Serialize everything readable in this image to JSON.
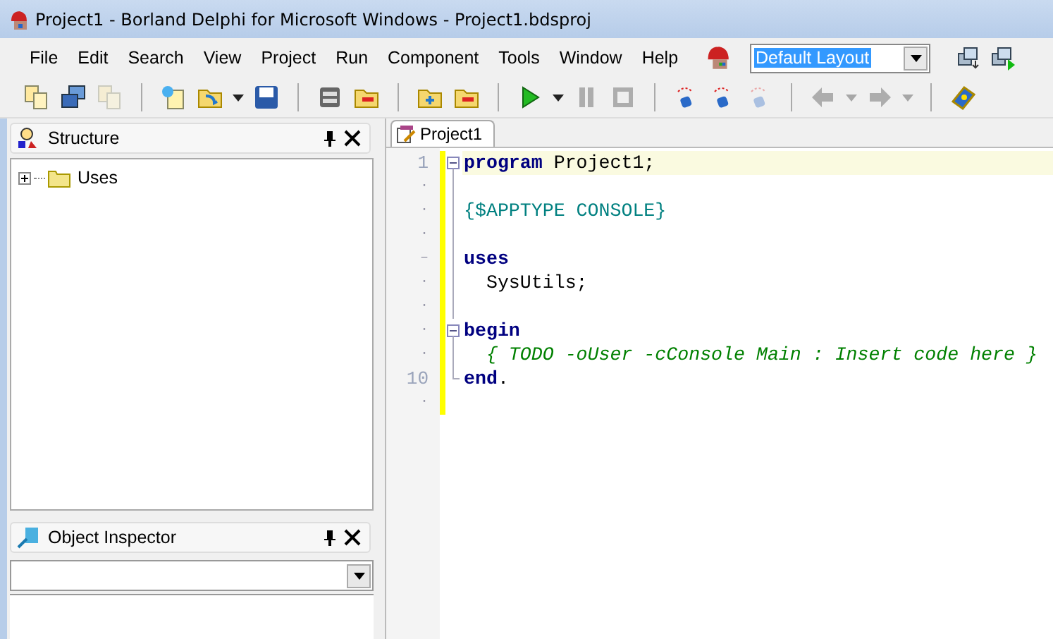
{
  "window": {
    "title": "Project1 - Borland Delphi for Microsoft Windows - Project1.bdsproj"
  },
  "menu": [
    "File",
    "Edit",
    "Search",
    "View",
    "Project",
    "Run",
    "Component",
    "Tools",
    "Window",
    "Help"
  ],
  "layout_combo": {
    "value": "Default Layout"
  },
  "layout_buttons": [
    {
      "kind": "save-layout",
      "disabled": false
    },
    {
      "kind": "apply-layout",
      "disabled": false
    }
  ],
  "toolbar": [
    {
      "buttons": [
        {
          "kind": "pages",
          "disabled": false
        },
        {
          "kind": "windows",
          "disabled": false
        },
        {
          "kind": "pages",
          "disabled": true
        }
      ]
    },
    {
      "buttons": [
        {
          "kind": "new",
          "disabled": false
        },
        {
          "kind": "open",
          "disabled": false
        },
        {
          "kind": "caret",
          "disabled": false
        },
        {
          "kind": "save",
          "disabled": false
        }
      ]
    },
    {
      "buttons": [
        {
          "kind": "stack",
          "disabled": false
        },
        {
          "kind": "remove",
          "disabled": false
        }
      ]
    },
    {
      "buttons": [
        {
          "kind": "add",
          "disabled": false
        },
        {
          "kind": "remove",
          "disabled": false
        }
      ]
    },
    {
      "buttons": [
        {
          "kind": "play",
          "disabled": false
        },
        {
          "kind": "caret",
          "disabled": false
        },
        {
          "kind": "pause",
          "disabled": true
        },
        {
          "kind": "stop",
          "disabled": true
        }
      ]
    },
    {
      "buttons": [
        {
          "kind": "step",
          "disabled": false
        },
        {
          "kind": "step",
          "disabled": false
        },
        {
          "kind": "step",
          "disabled": true
        }
      ]
    },
    {
      "buttons": [
        {
          "kind": "back",
          "disabled": true
        },
        {
          "kind": "caret",
          "disabled": true
        },
        {
          "kind": "forward",
          "disabled": true
        },
        {
          "kind": "caret",
          "disabled": true
        }
      ]
    },
    {
      "buttons": [
        {
          "kind": "help",
          "disabled": false
        }
      ]
    }
  ],
  "structure": {
    "title": "Structure",
    "tree": [
      {
        "label": "Uses",
        "expanded": false
      }
    ]
  },
  "object_inspector": {
    "title": "Object Inspector"
  },
  "editor": {
    "tab": {
      "label": "Project1",
      "selected": true
    },
    "lines": [
      {
        "gutter": "1",
        "kind": "fold-start",
        "selected": true,
        "tokens": [
          {
            "kind": "keyword",
            "text": "program"
          },
          {
            "kind": "plain",
            "text": " Project1;"
          }
        ]
      },
      {
        "gutter": "·",
        "kind": "fold-body",
        "selected": false
      },
      {
        "gutter": "·",
        "kind": "fold-body",
        "selected": false,
        "tokens": [
          {
            "kind": "directive",
            "text": "{$APPTYPE CONSOLE}"
          }
        ]
      },
      {
        "gutter": "·",
        "kind": "fold-body",
        "selected": false
      },
      {
        "gutter": "–",
        "kind": "fold-body",
        "selected": false,
        "tokens": [
          {
            "kind": "keyword",
            "text": "uses"
          }
        ]
      },
      {
        "gutter": "·",
        "kind": "fold-body",
        "selected": false,
        "tokens": [
          {
            "kind": "plain",
            "text": "  SysUtils;"
          }
        ]
      },
      {
        "gutter": "·",
        "kind": "fold-body",
        "selected": false
      },
      {
        "gutter": "·",
        "kind": "fold-start",
        "selected": false,
        "tokens": [
          {
            "kind": "keyword",
            "text": "begin"
          }
        ]
      },
      {
        "gutter": "·",
        "kind": "fold-body",
        "selected": false,
        "tokens": [
          {
            "kind": "comment",
            "text": "  { TODO -oUser -cConsole Main : Insert code here }"
          }
        ]
      },
      {
        "gutter": "10",
        "kind": "fold-end",
        "selected": false,
        "tokens": [
          {
            "kind": "keyword",
            "text": "end"
          },
          {
            "kind": "plain",
            "text": "."
          }
        ]
      },
      {
        "gutter": "·",
        "kind": "plain",
        "selected": false
      }
    ]
  }
}
